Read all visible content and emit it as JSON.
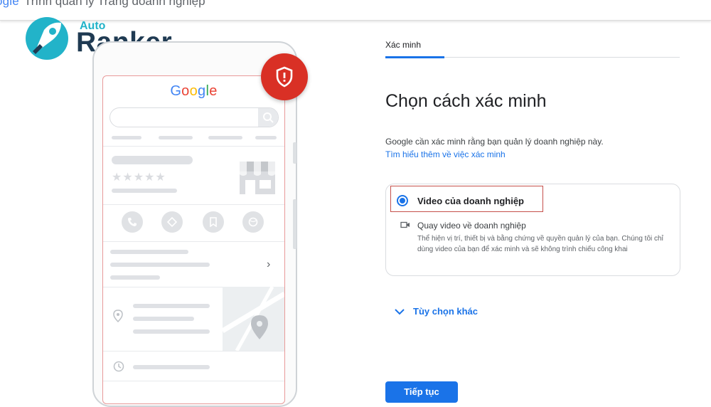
{
  "header": {
    "brand_partial": "ogle",
    "title_partial": "Trình quản lý Trang doanh nghiệp"
  },
  "watermark": {
    "line1": "Auto",
    "line2": "Ranker"
  },
  "phone": {
    "google_letters": [
      "G",
      "o",
      "o",
      "g",
      "l",
      "e"
    ],
    "rating_stars": "★★★★★"
  },
  "tabs": {
    "active_label": "Xác minh"
  },
  "main": {
    "title": "Chọn cách xác minh",
    "description": "Google cần xác minh rằng bạn quản lý doanh nghiệp này.",
    "learn_more_link": "Tìm hiểu thêm về việc xác minh"
  },
  "option": {
    "label": "Video của doanh nghiệp",
    "sub_title": "Quay video về doanh nghiệp",
    "sub_desc": "Thể hiện vị trí, thiết bị và bằng chứng về quyền quản lý của bạn. Chúng tôi chỉ dùng video của bạn để xác minh và sẽ không trình chiếu công khai"
  },
  "more_options": {
    "label": "Tùy chọn khác"
  },
  "actions": {
    "next_label": "Tiếp tục"
  },
  "colors": {
    "accent": "#1a73e8",
    "shield": "#d93025",
    "highlight_border": "#c5504b"
  }
}
